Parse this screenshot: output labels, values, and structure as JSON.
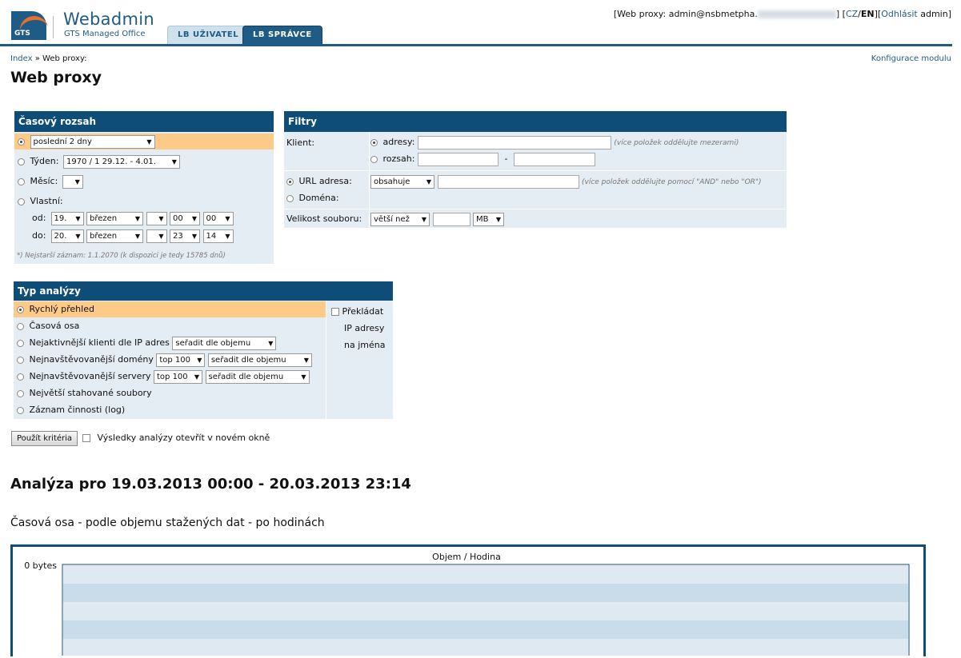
{
  "logo": {
    "short": "GTS",
    "title": "Webadmin",
    "subtitle": "GTS Managed Office"
  },
  "tabs": [
    {
      "label": "LB UŽIVATEL"
    },
    {
      "label": "LB SPRÁVCE"
    }
  ],
  "userbar": {
    "prefix": "[Web proxy: admin@nsbmetpha.",
    "suffix": "]",
    "lang_open": " [",
    "lang_cz": "CZ",
    "lang_sep": "/",
    "lang_en": "EN",
    "lang_close": "]",
    "logout_open": "[",
    "logout": "Odhlásit",
    "user": " admin]"
  },
  "breadcrumb": {
    "home": "Index",
    "sep": " » ",
    "current": "Web proxy:"
  },
  "config_link": "Konfigurace modulu",
  "page_title": "Web proxy",
  "time_range": {
    "title": "Časový rozsah",
    "preset_value": "poslední 2 dny",
    "week_label": "Týden:",
    "week_value": "1970 / 1  29.12. - 4.01.",
    "month_label": "Měsíc:",
    "custom_label": "Vlastní:",
    "from_label": "od:",
    "to_label": "do:",
    "from": {
      "day": "19.",
      "month": "březen",
      "year": "",
      "hour": "00",
      "minute": "00"
    },
    "to": {
      "day": "20.",
      "month": "březen",
      "year": "",
      "hour": "23",
      "minute": "14"
    },
    "note": "*) Nejstarší záznam: 1.1.2070 (k dispozici je tedy 15785 dnů)"
  },
  "filters": {
    "title": "Filtry",
    "client_label": "Klient:",
    "addresses_label": "adresy:",
    "addresses_hint": "(více položek oddělujte mezerami)",
    "range_label": "rozsah:",
    "range_sep": "-",
    "url_label": "URL adresa:",
    "url_op": "obsahuje",
    "url_hint": "(více položek oddělujte pomocí \"AND\" nebo \"OR\")",
    "domain_label": "Doména:",
    "size_label": "Velikost souboru:",
    "size_op": "větší než",
    "size_unit": "MB"
  },
  "analysis": {
    "title": "Typ analýzy",
    "options": [
      {
        "label": "Rychlý přehled"
      },
      {
        "label": "Časová osa"
      },
      {
        "label": "Nejaktivnější klienti dle IP adres"
      },
      {
        "label": "Nejnavštěvovanější domény"
      },
      {
        "label": "Nejnavštěvovanější servery"
      },
      {
        "label": "Největší stahované soubory"
      },
      {
        "label": "Záznam činnosti (log)"
      }
    ],
    "sort_value": "seřadit dle objemu",
    "top_value": "top 100",
    "translate_line1": "Překládat",
    "translate_line2": "IP adresy",
    "translate_line3": "na jména"
  },
  "apply_button": "Použít kritéria",
  "new_window_label": "Výsledky analýzy otevřít v novém okně",
  "result_title": "Analýza pro 19.03.2013 00:00 - 20.03.2013 23:14",
  "result_subtitle": "Časová osa - podle objemu stažených dat - po hodinách",
  "chart_data": {
    "type": "bar",
    "title": "Objem / Hodina",
    "y_tick_labels": [
      "0 bytes"
    ],
    "categories": [],
    "values": []
  }
}
